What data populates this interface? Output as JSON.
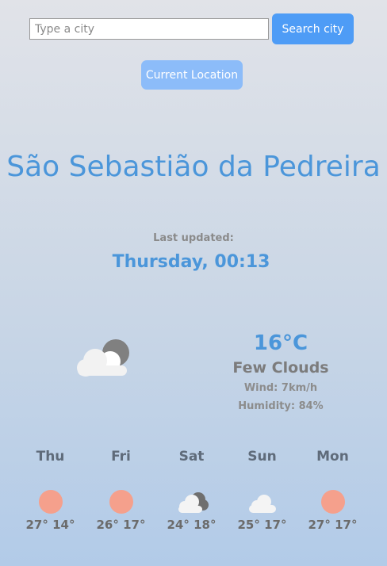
{
  "search": {
    "placeholder": "Type a city",
    "button_label": "Search city"
  },
  "location_button_label": "Current Location",
  "city": "São Sebastião da Pedreira",
  "updated": {
    "label": "Last updated:",
    "time": "Thursday, 00:13"
  },
  "current": {
    "icon": "partly-cloudy-night-icon",
    "temperature": "16°C",
    "description": "Few Clouds",
    "wind": "Wind: 7km/h",
    "humidity": "Humidity: 84%"
  },
  "forecast": [
    {
      "day": "Thu",
      "icon": "sun-icon",
      "max": "27°",
      "min": "14°"
    },
    {
      "day": "Fri",
      "icon": "sun-icon",
      "max": "26°",
      "min": "17°"
    },
    {
      "day": "Sat",
      "icon": "broken-clouds-icon",
      "max": "24°",
      "min": "18°"
    },
    {
      "day": "Sun",
      "icon": "cloud-icon",
      "max": "25°",
      "min": "17°"
    },
    {
      "day": "Mon",
      "icon": "sun-icon",
      "max": "27°",
      "min": "17°"
    }
  ],
  "colors": {
    "accent": "#4b96da",
    "button": "#4e9cf6",
    "location_button": "#8cbcf9",
    "sun": "#f5a08c"
  }
}
